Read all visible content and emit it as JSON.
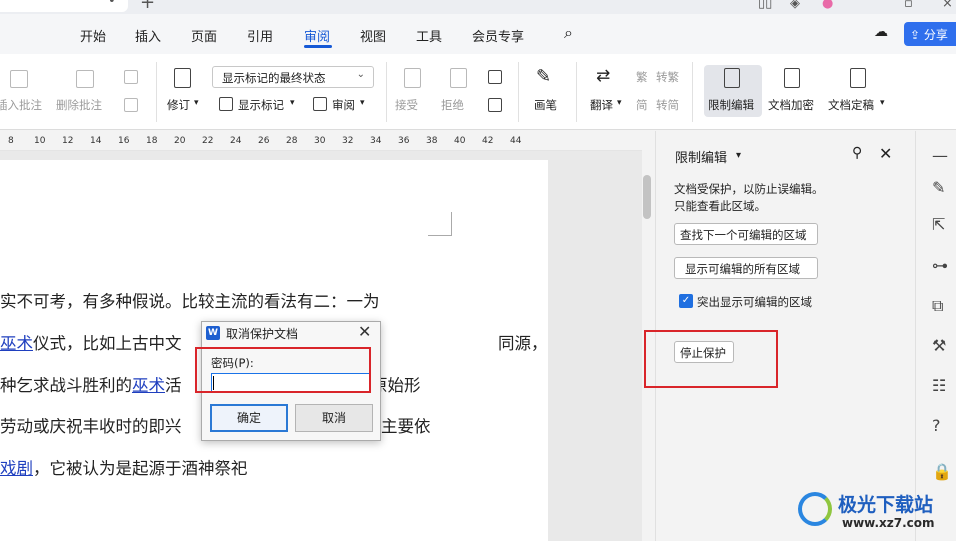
{
  "menu": {
    "items": [
      "开始",
      "插入",
      "页面",
      "引用",
      "审阅",
      "视图",
      "工具",
      "会员专享"
    ],
    "active": "审阅",
    "share_label": "分享"
  },
  "ribbon": {
    "insert_comment": "插入批注",
    "delete_comment": "删除批注",
    "track": "修订",
    "show_markup_mode": "显示标记的最终状态",
    "show_markup": "显示标记",
    "review": "审阅",
    "accept": "接受",
    "reject": "拒绝",
    "pen": "画笔",
    "translate": "翻译",
    "to_traditional": "转繁",
    "to_simplified": "转简",
    "restrict_edit": "限制编辑",
    "doc_encrypt": "文档加密",
    "doc_finalize": "文档定稿"
  },
  "ruler": {
    "ticks": [
      "8",
      "10",
      "12",
      "14",
      "16",
      "18",
      "20",
      "22",
      "24",
      "26",
      "28",
      "30",
      "32",
      "34",
      "36",
      "38",
      "40",
      "42",
      "44"
    ]
  },
  "document": {
    "line1": "实不可考，有多种假说。比较主流的看法有二：一为",
    "line2_link": "巫术",
    "line2_text": "仪式，比如上古中文",
    "line2_tail": "同源，",
    "line3_pre": "种乞求战斗胜利的",
    "line3_link": "巫术",
    "line3_mid": "活",
    "line3_tail": "原始形",
    "line4_pre": "劳动或庆祝丰收时的即兴",
    "line4_tail": "主要依",
    "line5_link": "戏剧",
    "line5_text": "，它被认为是起源于酒神祭祀"
  },
  "panel": {
    "title": "限制编辑",
    "desc1": "文档受保护，以防止误编辑。",
    "desc2": "只能查看此区域。",
    "btn_find_next": "查找下一个可编辑的区域",
    "btn_show_all": "显示可编辑的所有区域",
    "highlight_label": "突出显示可编辑的区域",
    "highlight_checked": true,
    "btn_stop": "停止保护"
  },
  "dialog": {
    "title": "取消保护文档",
    "password_label": "密码(P):",
    "password_value": "",
    "ok": "确定",
    "cancel": "取消"
  },
  "watermark": {
    "name": "极光下载站",
    "url": "www.xz7.com"
  },
  "colors": {
    "accent": "#1659d6",
    "highlight_red": "#d9252a",
    "link": "#1f3fbf"
  }
}
